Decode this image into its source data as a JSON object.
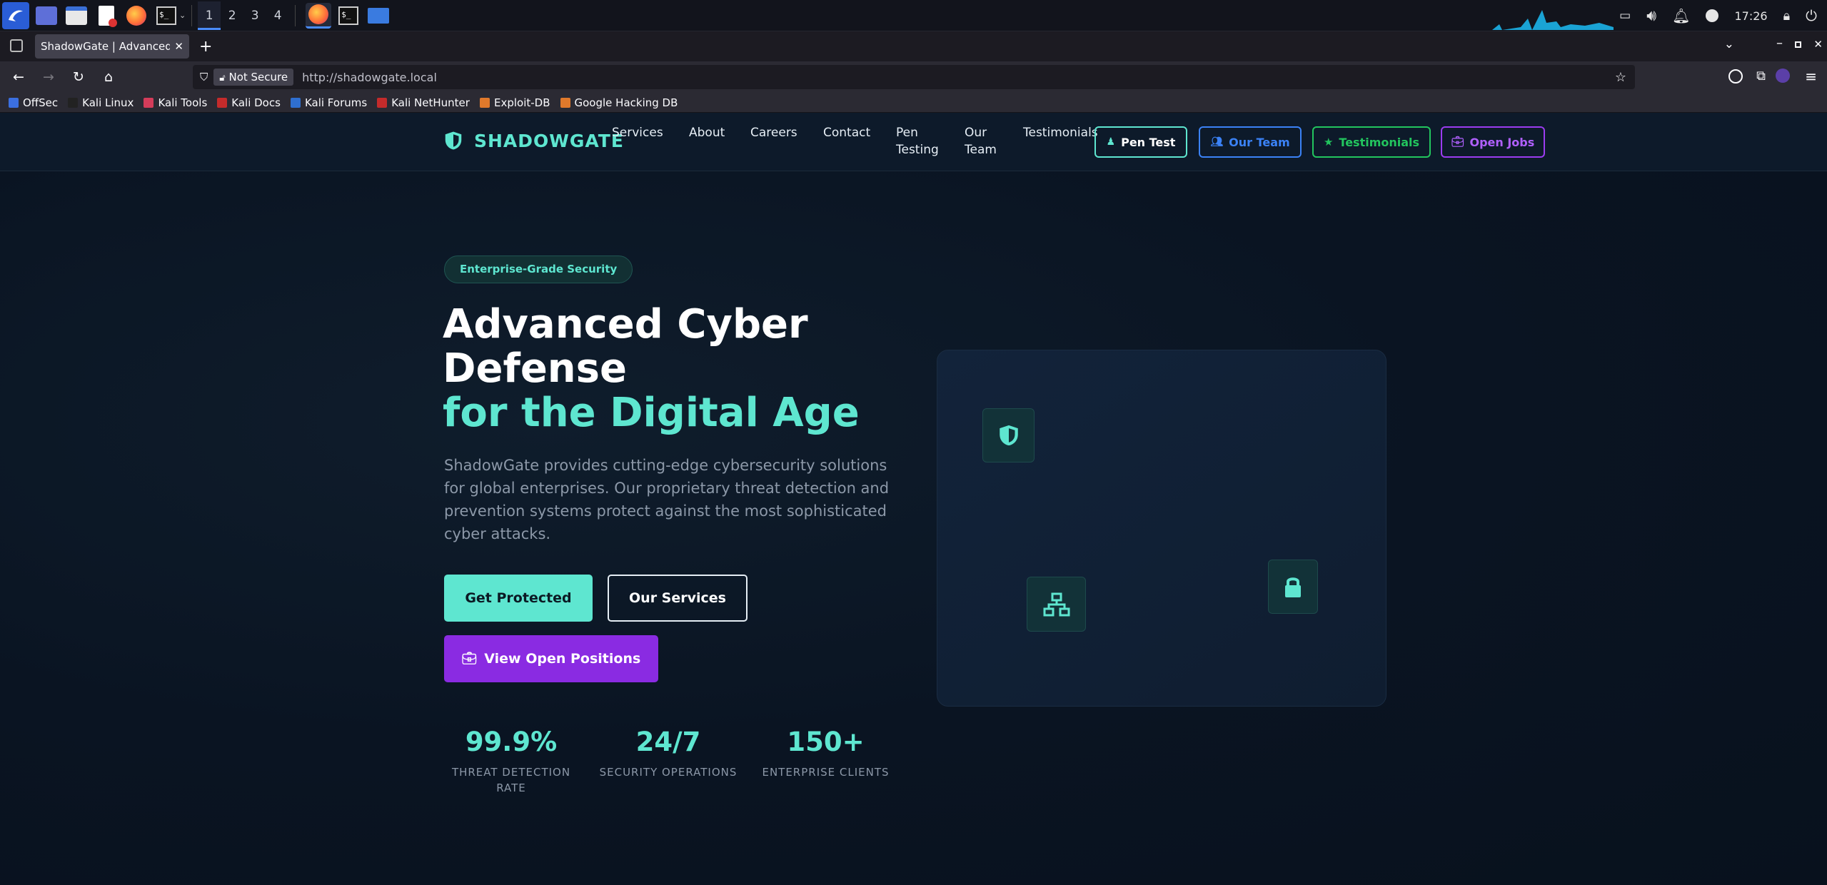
{
  "os": {
    "workspaces": [
      "1",
      "2",
      "3",
      "4"
    ],
    "clock": "17:26"
  },
  "browser": {
    "tab_title": "ShadowGate | Advanced Cybe",
    "not_secure": "Not Secure",
    "url": "http://shadowgate.local",
    "bookmarks": [
      "OffSec",
      "Kali Linux",
      "Kali Tools",
      "Kali Docs",
      "Kali Forums",
      "Kali NetHunter",
      "Exploit-DB",
      "Google Hacking DB"
    ]
  },
  "site": {
    "brand": "SHADOWGATE",
    "menu": [
      "Services",
      "About",
      "Careers",
      "Contact",
      "Pen",
      "Testing",
      "Our",
      "Team",
      "Testimonials"
    ],
    "pills": [
      "Pen Test",
      "Our Team",
      "Testimonials",
      "Open Jobs"
    ],
    "badge": "Enterprise-Grade Security",
    "title_line1": "Advanced Cyber",
    "title_line2": "Defense",
    "title_line3": "for the Digital Age",
    "description": "ShadowGate provides cutting-edge cybersecurity solutions for global enterprises. Our proprietary threat detection and prevention systems protect against the most sophisticated cyber attacks.",
    "btn_primary": "Get Protected",
    "btn_outline": "Our Services",
    "btn_purple": "View Open Positions",
    "stats": [
      {
        "value": "99.9%",
        "label_1": "THREAT DETECTION",
        "label_2": "RATE"
      },
      {
        "value": "24/7",
        "label_1": "SECURITY OPERATIONS",
        "label_2": ""
      },
      {
        "value": "150+",
        "label_1": "ENTERPRISE CLIENTS",
        "label_2": ""
      }
    ]
  },
  "colors": {
    "accent": "#5ee6d0",
    "blue": "#3b82f6",
    "green": "#22c55e",
    "purple": "#8a2be2"
  }
}
